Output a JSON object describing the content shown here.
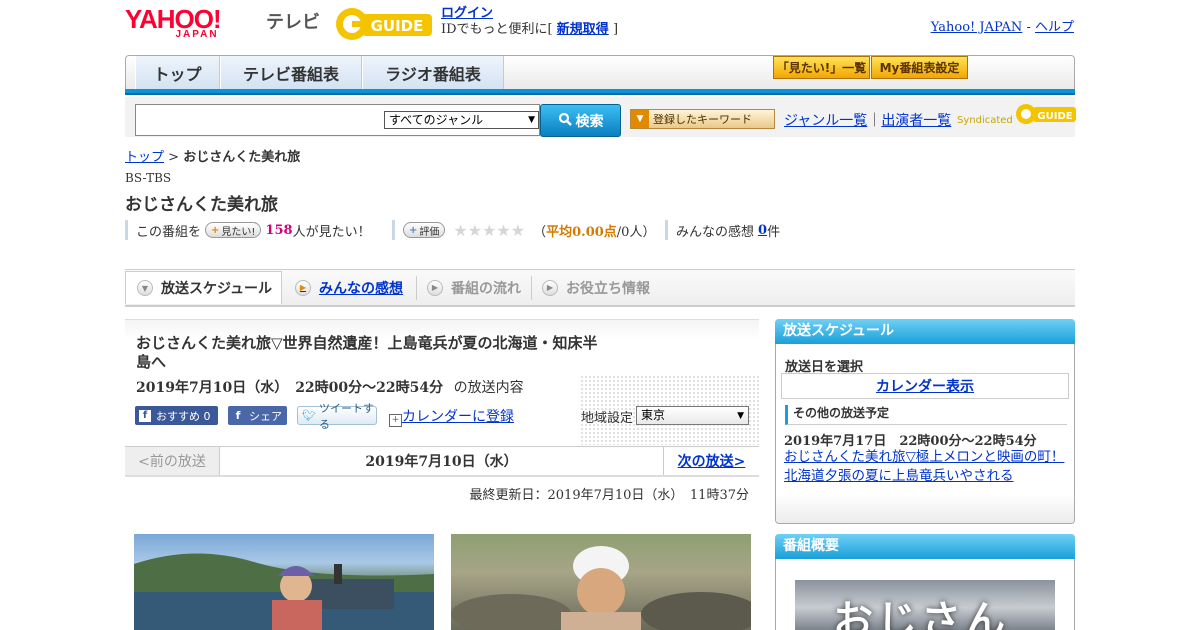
{
  "header": {
    "logo_yahoo": "YAHOO!",
    "logo_japan": "JAPAN",
    "logo_tv": "テレビ",
    "logo_guide": "GUIDE",
    "login_link": "ログイン",
    "login_text": "IDでもっと便利に[",
    "signup_link": "新規取得",
    "login_close": "]",
    "right_yahoo": "Yahoo! JAPAN",
    "right_sep": " - ",
    "right_help": "ヘルプ"
  },
  "nav": {
    "tabs": [
      "トップ",
      "テレビ番組表",
      "ラジオ番組表"
    ],
    "want_list": "「見たい!」一覧",
    "my_schedule": "My番組表設定"
  },
  "search": {
    "genre": "すべてのジャンル",
    "button": "検索",
    "keyword_button": "登録したキーワード",
    "genre_list": "ジャンル一覧",
    "sep": "｜",
    "cast_list": "出演者一覧",
    "syndicated": "Syndicated",
    "syndicated_logo": "GUIDE"
  },
  "breadcrumb": {
    "top": "トップ",
    "sep": " > ",
    "current": "おじさんくた美れ旅"
  },
  "program": {
    "channel": "BS-TBS",
    "title": "おじさんくた美れ旅",
    "want_prefix": "この番組を",
    "want_button": "見たい!",
    "want_count": "158",
    "want_suffix": "人が見たい！",
    "rate_button": "評価",
    "stars": "★★★★★",
    "avg_open": "（",
    "avg_label": "平均0.00点",
    "avg_suffix": "/0人）",
    "impressions_label": "みんなの感想",
    "impressions_count": "0",
    "impressions_unit": "件"
  },
  "subtabs": [
    "放送スケジュール",
    "みんなの感想",
    "番組の流れ",
    "お役立ち情報"
  ],
  "episode": {
    "title": "おじさんくた美れ旅▽世界自然遺産！上島竜兵が夏の北海道・知床半島へ",
    "date": "2019年7月10日（水）　22時00分～22時54分",
    "date_suffix": "の放送内容",
    "fb_recommend": "おすすめ 0",
    "fb_share": "シェア",
    "tweet": "ツイートする",
    "calendar": "カレンダーに登録",
    "region_label": "地域設定",
    "region_value": "東京"
  },
  "pager": {
    "prev": "<前の放送",
    "date": "2019年7月10日（水）",
    "next": "次の放送>"
  },
  "updated": "最終更新日：2019年7月10日（水）　11時37分",
  "sidebar": {
    "schedule_head": "放送スケジュール",
    "select_date": "放送日を選択",
    "calendar_view": "カレンダー表示",
    "other_head": "その他の放送予定",
    "next_date": "2019年7月17日　22時00分～22時54分",
    "next_title": "おじさんくた美れ旅▽極上メロンと映画の町！北海道夕張の夏に上島竜兵いやされる",
    "summary_head": "番組概要",
    "thumb_text": "おじさん"
  }
}
